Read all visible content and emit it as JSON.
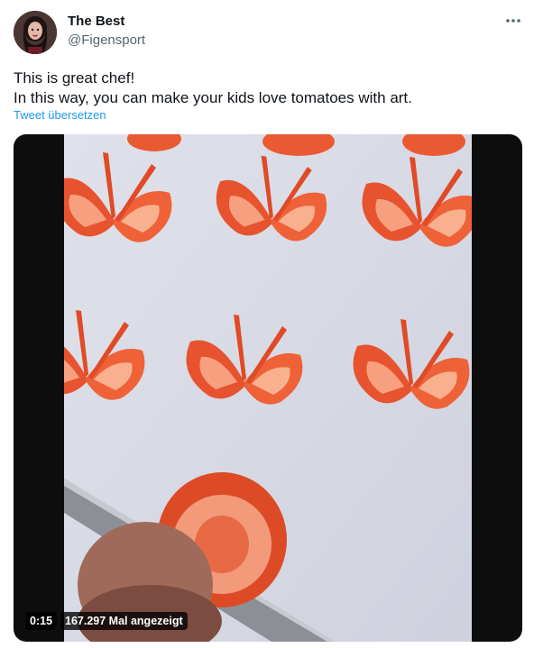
{
  "tweet": {
    "author": {
      "display_name": "The Best",
      "handle": "@Figensport"
    },
    "more_icon": "more-horizontal-icon",
    "text_lines": [
      "This is great chef!",
      "In this way, you can make your kids love tomatoes with art."
    ],
    "translate_label": "Tweet übersetzen",
    "media": {
      "type": "video",
      "duration": "0:15",
      "view_count": "167.297 Mal angezeigt"
    }
  },
  "colors": {
    "text": "#0f1419",
    "secondary": "#536471",
    "link": "#1d9bf0",
    "tomato": "#e8502e",
    "board": "#d9dce6"
  }
}
